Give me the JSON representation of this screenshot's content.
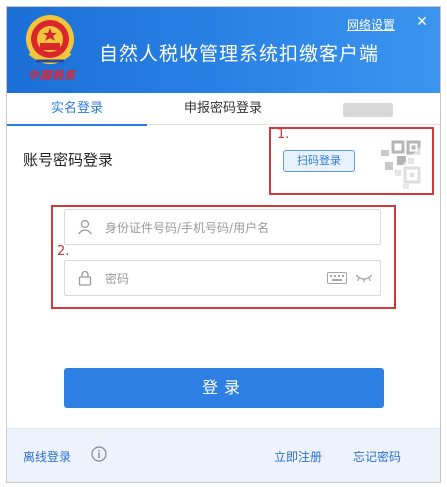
{
  "header": {
    "title": "自然人税收管理系统扣缴客户端",
    "network_settings": "网络设置",
    "close_symbol": "✕",
    "logo_caption": "中国税务"
  },
  "tabs": [
    {
      "label": "实名登录",
      "active": true
    },
    {
      "label": "申报密码登录",
      "active": false
    },
    {
      "label": "",
      "active": false
    }
  ],
  "login": {
    "section_title": "账号密码登录",
    "scan_button": "扫码登录",
    "annotation_1": "1.",
    "annotation_2": "2.",
    "username_placeholder": "身份证件号码/手机号码/用户名",
    "password_placeholder": "密码",
    "submit_label": "登录"
  },
  "footer": {
    "offline_login": "离线登录",
    "register": "立即注册",
    "forgot_password": "忘记密码"
  },
  "icons": {
    "user": "user-icon",
    "lock": "lock-icon",
    "keyboard": "keyboard-icon",
    "eye": "eye-closed-icon",
    "qr": "qr-code-icon",
    "info": "info-icon"
  },
  "colors": {
    "brand_blue": "#2b7be0",
    "annotation_red": "#d13a3a",
    "button_blue": "#2d7fe3"
  }
}
